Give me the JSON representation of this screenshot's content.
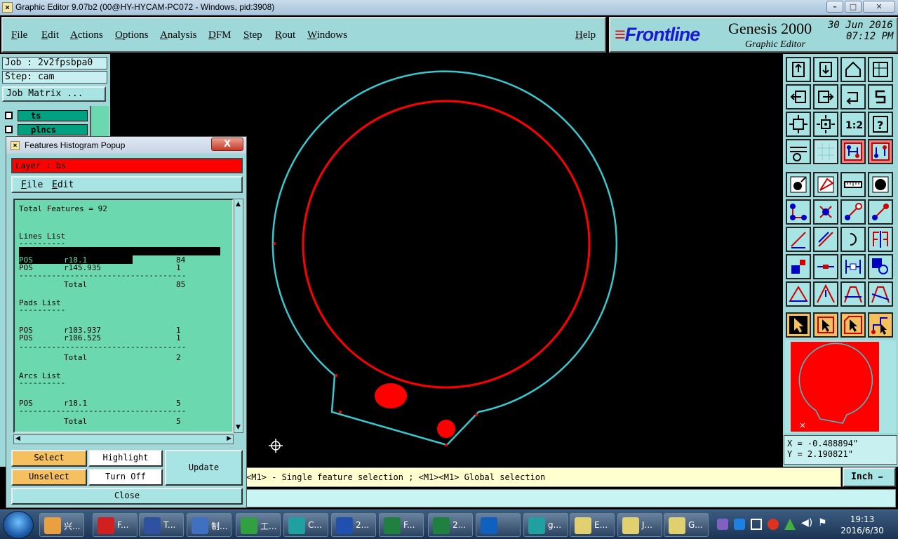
{
  "window": {
    "title": "Graphic Editor 9.07b2 (00@HY-HYCAM-PC072 - Windows, pid:3908)"
  },
  "menu": [
    "File",
    "Edit",
    "Actions",
    "Options",
    "Analysis",
    "DFM",
    "Step",
    "Rout",
    "Windows"
  ],
  "help_label": "Help",
  "brand": {
    "logo": "Frontline",
    "product": "Genesis 2000",
    "subtitle": "Graphic Editor",
    "date": "30 Jun 2016",
    "time": "07:12 PM"
  },
  "job": {
    "job_label": "Job : 2v2fpsbpa0",
    "step_label": "Step: cam",
    "matrix_button": "Job Matrix ..."
  },
  "layers": [
    {
      "name": "ts",
      "color": "#00a080"
    },
    {
      "name": "plncs",
      "color": "#00a080"
    }
  ],
  "popup": {
    "title": "Features Histogram Popup",
    "layer_label": "Layer :  bs",
    "menu": [
      "File",
      "Edit"
    ],
    "total_features": "Total Features = 92",
    "lines_header": "Lines List",
    "lines": [
      {
        "pol": "POS",
        "sym": "r18.1",
        "count": "84"
      },
      {
        "pol": "POS",
        "sym": "r145.935",
        "count": "1"
      }
    ],
    "lines_total": "85",
    "pads_header": "Pads List",
    "pads": [
      {
        "pol": "POS",
        "sym": "r103.937",
        "count": "1"
      },
      {
        "pol": "POS",
        "sym": "r106.525",
        "count": "1"
      }
    ],
    "pads_total": "2",
    "arcs_header": "Arcs List",
    "arcs": [
      {
        "pol": "POS",
        "sym": "r18.1",
        "count": "5"
      }
    ],
    "arcs_total": "5",
    "total_label": "Total",
    "divider_short": "----------",
    "divider_long": "------------------------------------",
    "buttons": {
      "select": "Select",
      "unselect": "Unselect",
      "highlight": "Highlight",
      "turn_off": "Turn Off",
      "update": "Update",
      "close": "Close"
    },
    "close_x": "X"
  },
  "status": {
    "message": "<M1> - Single feature selection ; <M1><M1> Global selection",
    "unit": "Inch"
  },
  "coords": {
    "x": "X = -0.488894\"",
    "y": "Y = 2.190821\""
  },
  "taskbar": {
    "items": [
      {
        "label": "兴...",
        "color": "#e8a040"
      },
      {
        "label": "F...",
        "color": "#d02020"
      },
      {
        "label": "T...",
        "color": "#3050a0"
      },
      {
        "label": "制...",
        "color": "#4070c0"
      },
      {
        "label": "工...",
        "color": "#30a040"
      },
      {
        "label": "C...",
        "color": "#20a0a0"
      },
      {
        "label": "2...",
        "color": "#2050b0"
      },
      {
        "label": "F...",
        "color": "#208040"
      },
      {
        "label": "2...",
        "color": "#208040"
      },
      {
        "label": "",
        "color": "#1060c0"
      },
      {
        "label": "g...",
        "color": "#20a0a0"
      },
      {
        "label": "E...",
        "color": "#e0d070"
      },
      {
        "label": "J...",
        "color": "#e0d070"
      },
      {
        "label": "G...",
        "color": "#e0d070"
      }
    ],
    "clock_time": "19:13",
    "clock_date": "2016/6/30"
  },
  "colors": {
    "panel": "#9fd8d8",
    "outline": "#38c8d0",
    "feature": "#ff0000",
    "highlight_btn": "#f4c060"
  }
}
